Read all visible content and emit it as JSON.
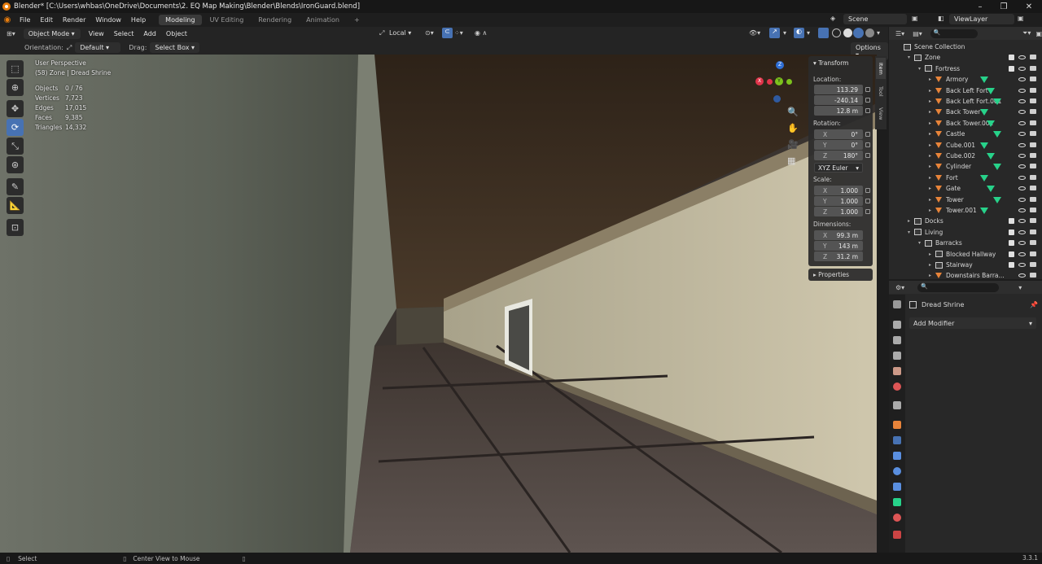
{
  "window": {
    "title": "Blender* [C:\\Users\\whbas\\OneDrive\\Documents\\2. EQ Map Making\\Blender\\Blends\\IronGuard.blend]"
  },
  "menu": {
    "items": [
      "File",
      "Edit",
      "Render",
      "Window",
      "Help"
    ]
  },
  "workspaces": {
    "tabs": [
      "Modeling",
      "UV Editing",
      "Rendering",
      "Animation"
    ],
    "add": "+"
  },
  "scene": {
    "name": "Scene",
    "view_layer": "ViewLayer"
  },
  "viewport_header": {
    "mode": "Object Mode",
    "menus": [
      "View",
      "Select",
      "Add",
      "Object"
    ],
    "transform_space": "Local"
  },
  "tool_header": {
    "orientation_label": "Orientation:",
    "orientation_value": "Default",
    "drag_label": "Drag:",
    "drag_value": "Select Box",
    "options": "Options"
  },
  "overlay": {
    "view_name": "User Perspective",
    "context": "(58) Zone | Dread Shrine",
    "stats": [
      {
        "label": "Objects",
        "value": "0 / 76"
      },
      {
        "label": "Vertices",
        "value": "7,723"
      },
      {
        "label": "Edges",
        "value": "17,015"
      },
      {
        "label": "Faces",
        "value": "9,385"
      },
      {
        "label": "Triangles",
        "value": "14,332"
      }
    ]
  },
  "gizmo": {
    "x": "X",
    "y": "Y",
    "z": "Z"
  },
  "npanel": {
    "title": "Transform",
    "location_label": "Location:",
    "location": [
      "113.29",
      "-240.14",
      "12.8 m"
    ],
    "rotation_label": "Rotation:",
    "rotation": [
      {
        "axis": "X",
        "value": "0°"
      },
      {
        "axis": "Y",
        "value": "0°"
      },
      {
        "axis": "Z",
        "value": "180°"
      }
    ],
    "rotation_mode": "XYZ Euler",
    "scale_label": "Scale:",
    "scale": [
      {
        "axis": "X",
        "value": "1.000"
      },
      {
        "axis": "Y",
        "value": "1.000"
      },
      {
        "axis": "Z",
        "value": "1.000"
      }
    ],
    "dimensions_label": "Dimensions:",
    "dimensions": [
      {
        "axis": "X",
        "value": "99.3 m"
      },
      {
        "axis": "Y",
        "value": "143 m"
      },
      {
        "axis": "Z",
        "value": "31.2 m"
      }
    ],
    "properties": "Properties",
    "tabs": [
      "Item",
      "Tool",
      "View"
    ]
  },
  "outliner": {
    "rows": [
      {
        "label": "Scene Collection",
        "depth": 0,
        "type": "scene",
        "arrow": ""
      },
      {
        "label": "Zone",
        "depth": 1,
        "type": "coll",
        "arrow": "▾"
      },
      {
        "label": "Fortress",
        "depth": 2,
        "type": "coll",
        "arrow": "▾"
      },
      {
        "label": "Armory",
        "depth": 3,
        "type": "mesh",
        "arrow": "▸"
      },
      {
        "label": "Back Left Fort",
        "depth": 3,
        "type": "mesh",
        "arrow": "▸"
      },
      {
        "label": "Back Left Fort.001",
        "depth": 3,
        "type": "mesh",
        "arrow": "▸"
      },
      {
        "label": "Back Tower",
        "depth": 3,
        "type": "mesh",
        "arrow": "▸"
      },
      {
        "label": "Back Tower.001",
        "depth": 3,
        "type": "mesh",
        "arrow": "▸"
      },
      {
        "label": "Castle",
        "depth": 3,
        "type": "mesh",
        "arrow": "▸"
      },
      {
        "label": "Cube.001",
        "depth": 3,
        "type": "mesh",
        "arrow": "▸"
      },
      {
        "label": "Cube.002",
        "depth": 3,
        "type": "mesh",
        "arrow": "▸"
      },
      {
        "label": "Cylinder",
        "depth": 3,
        "type": "mesh",
        "arrow": "▸"
      },
      {
        "label": "Fort",
        "depth": 3,
        "type": "mesh",
        "arrow": "▸"
      },
      {
        "label": "Gate",
        "depth": 3,
        "type": "mesh",
        "arrow": "▸"
      },
      {
        "label": "Tower",
        "depth": 3,
        "type": "mesh",
        "arrow": "▸"
      },
      {
        "label": "Tower.001",
        "depth": 3,
        "type": "mesh",
        "arrow": "▸"
      },
      {
        "label": "Docks",
        "depth": 1,
        "type": "coll",
        "arrow": "▸"
      },
      {
        "label": "Living",
        "depth": 1,
        "type": "coll",
        "arrow": "▾"
      },
      {
        "label": "Barracks",
        "depth": 2,
        "type": "coll",
        "arrow": "▾"
      },
      {
        "label": "Blocked Hallway",
        "depth": 3,
        "type": "coll",
        "arrow": "▸"
      },
      {
        "label": "Stairway",
        "depth": 3,
        "type": "coll",
        "arrow": "▸"
      },
      {
        "label": "Downstairs Barra...",
        "depth": 3,
        "type": "mesh",
        "arrow": "▸"
      }
    ]
  },
  "properties_editor": {
    "object_name": "Dread Shrine",
    "add_modifier": "Add Modifier"
  },
  "statusbar": {
    "left": "Select",
    "middle": "Center View to Mouse",
    "version": "3.3.1"
  },
  "colors": {
    "accent": "#4772b3",
    "brand": "#e87d0d",
    "mesh_icon": "#27d28a"
  }
}
